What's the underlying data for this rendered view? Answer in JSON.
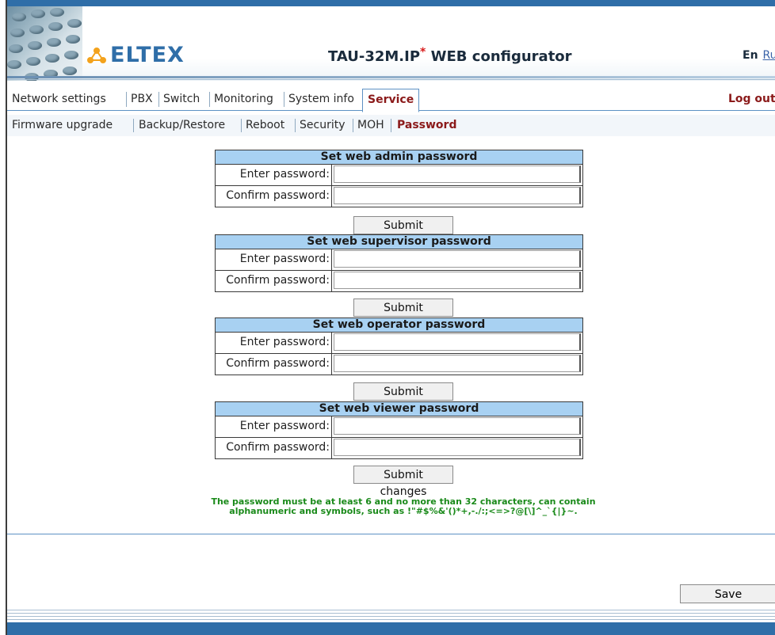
{
  "header": {
    "logo_text": "ELTEX",
    "title_main": "TAU-32M.IP",
    "title_star": "*",
    "title_suffix": " WEB configurator",
    "lang_en": "En",
    "lang_ru": "Ru"
  },
  "main_menu": {
    "items": [
      "Network settings",
      "PBX",
      "Switch",
      "Monitoring",
      "System info",
      "Service"
    ],
    "active": "Service",
    "logout": "Log out"
  },
  "sub_menu": {
    "items": [
      "Firmware upgrade",
      "Backup/Restore",
      "Reboot",
      "Security",
      "MOH",
      "Password"
    ],
    "active": "Password"
  },
  "password_sections": [
    {
      "title": "Set web admin password",
      "enter_label": "Enter password:",
      "confirm_label": "Confirm password:",
      "enter_value": "",
      "confirm_value": "",
      "submit_label": "Submit changes"
    },
    {
      "title": "Set web supervisor password",
      "enter_label": "Enter password:",
      "confirm_label": "Confirm password:",
      "enter_value": "",
      "confirm_value": "",
      "submit_label": "Submit changes"
    },
    {
      "title": "Set web operator password",
      "enter_label": "Enter password:",
      "confirm_label": "Confirm password:",
      "enter_value": "",
      "confirm_value": "",
      "submit_label": "Submit changes"
    },
    {
      "title": "Set web viewer password",
      "enter_label": "Enter password:",
      "confirm_label": "Confirm password:",
      "enter_value": "",
      "confirm_value": "",
      "submit_label": "Submit changes"
    }
  ],
  "note_line1": "The password must be at least 6 and no more than 32 characters, can contain",
  "note_line2": "alphanumeric and symbols, such as !\"#$%&'()*+,-./:;<=>?@[\\]^_`{|}~.",
  "save_label": "Save",
  "colors": {
    "accent_blue": "#2f6ea8",
    "section_header": "#a8d1f2",
    "active_menu": "#8b1a1a",
    "note_green": "#1a8a1a"
  }
}
